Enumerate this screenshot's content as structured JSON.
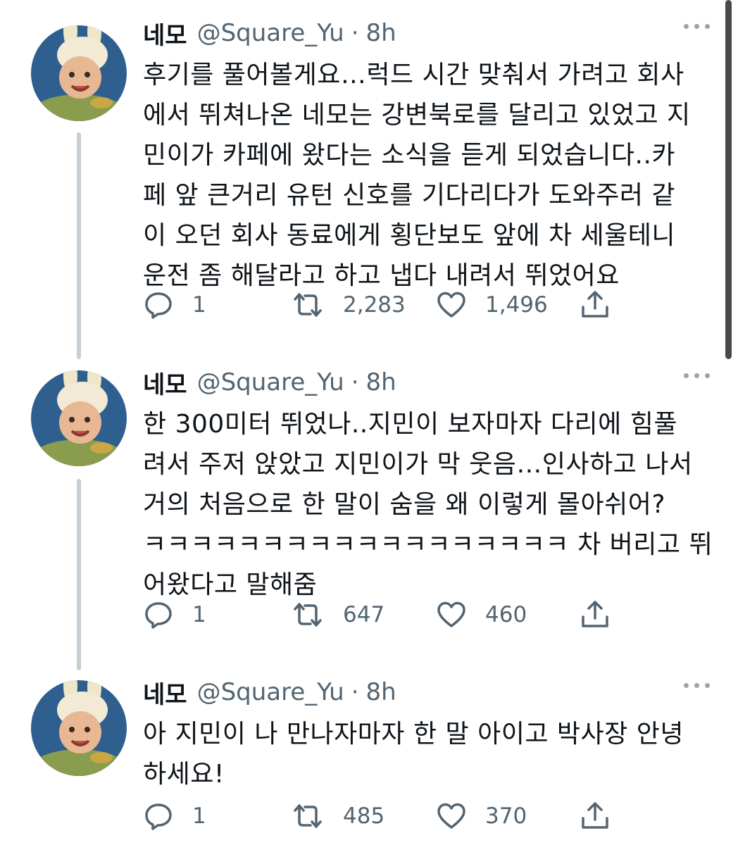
{
  "tweets": [
    {
      "name": "네모",
      "handle": "@Square_Yu",
      "separator": "·",
      "time": "8h",
      "lines": [
        "후기를 풀어볼게요…럭드 시간 맞춰서 가려고 회사",
        "에서 뛰쳐나온 네모는 강변북로를 달리고 있었고 지",
        "민이가 카페에 왔다는 소식을 듣게 되었습니다..카",
        "페 앞 큰거리 유턴 신호를 기다리다가 도와주러 같",
        "이 오던 회사 동료에게 횡단보도 앞에 차 세울테니",
        "운전 좀 해달라고 하고 냅다 내려서 뛰었어요"
      ],
      "replies": "1",
      "retweets": "2,283",
      "likes": "1,496"
    },
    {
      "name": "네모",
      "handle": "@Square_Yu",
      "separator": "·",
      "time": "8h",
      "lines": [
        "한 300미터 뛰었나..지민이 보자마자 다리에 힘풀",
        "려서 주저 앉았고 지민이가 막 웃음…인사하고 나서",
        "거의 처음으로 한 말이 숨을 왜 이렇게 몰아쉬어?",
        "ㅋㅋㅋㅋㅋㅋㅋㅋㅋㅋㅋㅋㅋㅋㅋㅋㅋㅋ 차 버리고 뛰",
        "어왔다고 말해줌"
      ],
      "replies": "1",
      "retweets": "647",
      "likes": "460"
    },
    {
      "name": "네모",
      "handle": "@Square_Yu",
      "separator": "·",
      "time": "8h",
      "lines": [
        "아 지민이 나 만나자마자 한 말 아이고 박사장 안녕",
        "하세요!"
      ],
      "replies": "1",
      "retweets": "485",
      "likes": "370"
    }
  ],
  "icons": {
    "reply": "reply-icon",
    "retweet": "retweet-icon",
    "like": "like-icon",
    "share": "share-icon",
    "more": "more-icon"
  },
  "colors": {
    "text": "#0f1419",
    "secondary": "#536471",
    "thread_line": "#c4cfd6",
    "background": "#ffffff"
  }
}
